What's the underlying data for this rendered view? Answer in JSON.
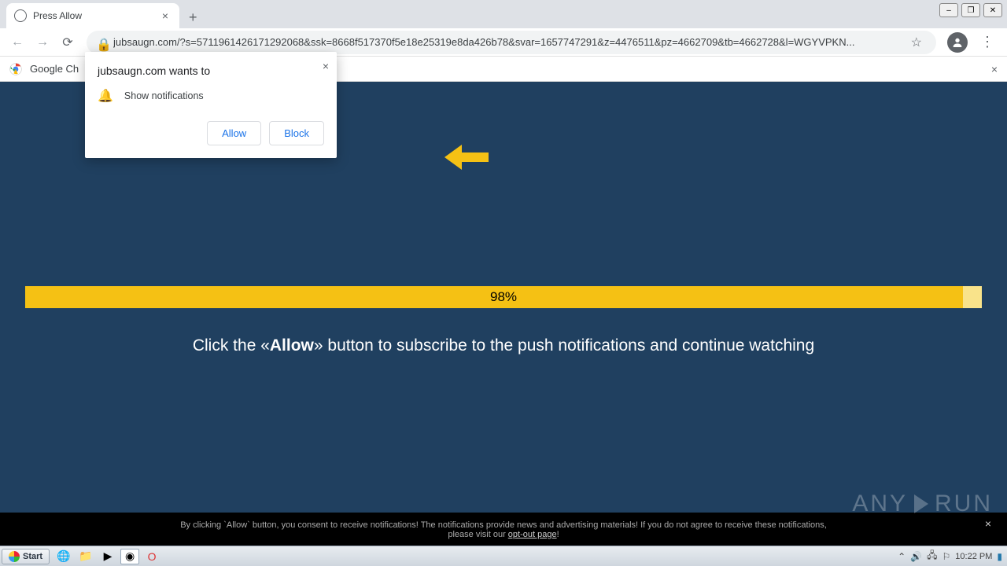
{
  "browser": {
    "tab_title": "Press Allow",
    "url": "jubsaugn.com/?s=5711961426171292068&ssk=8668f517370f5e18e25319e8da426b78&svar=1657747291&z=4476511&pz=4662709&tb=4662728&l=WGYVPKN...",
    "infobar_text": "Google Ch"
  },
  "perm": {
    "title": "jubsaugn.com wants to",
    "label": "Show notifications",
    "allow": "Allow",
    "block": "Block"
  },
  "page": {
    "progress_text": "98%",
    "instruction_prefix": "Click the «",
    "instruction_bold": "Allow",
    "instruction_suffix": "» button to subscribe to the push notifications and continue watching"
  },
  "consent": {
    "text_a": "By clicking `Allow` button, you consent to receive notifications! The notifications provide news and advertising materials! If you do not agree to receive these notifications,",
    "text_b": "please visit our ",
    "link": "opt-out page",
    "excl": "!"
  },
  "watermark": {
    "a": "ANY",
    "b": "RUN"
  },
  "taskbar": {
    "start": "Start",
    "time": "10:22 PM"
  }
}
